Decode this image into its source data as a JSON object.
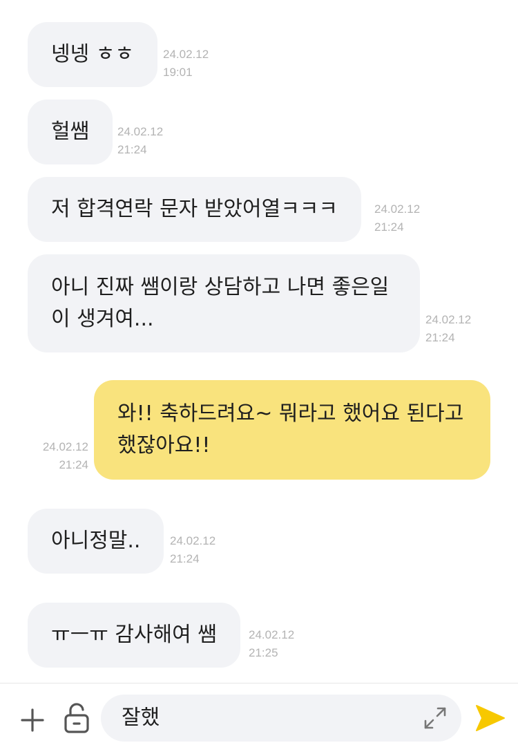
{
  "messages": [
    {
      "text": "넹넹 ㅎㅎ",
      "date": "24.02.12",
      "time": "19:01",
      "sender": "other"
    },
    {
      "text": "헐쌤",
      "date": "24.02.12",
      "time": "21:24",
      "sender": "other"
    },
    {
      "text": "저 합격연락 문자 받았어열ㅋㅋㅋ",
      "date": "24.02.12",
      "time": "21:24",
      "sender": "other"
    },
    {
      "line1": "아니 진짜 쌤이랑 상담하고 나면 좋은일",
      "line2": "이 생겨여...",
      "date": "24.02.12",
      "time": "21:24",
      "sender": "other"
    },
    {
      "line1": "와!! 축하드려요~ 뭐라고 했어요 된다고",
      "line2": "했잖아요!!",
      "date": "24.02.12",
      "time": "21:24",
      "sender": "me"
    },
    {
      "text": "아니정말..",
      "date": "24.02.12",
      "time": "21:24",
      "sender": "other"
    },
    {
      "text": "ㅠㅡㅠ 감사해여 쌤",
      "date": "24.02.12",
      "time": "21:25",
      "sender": "other"
    }
  ],
  "composer": {
    "input_value": "잘했",
    "icons": [
      "plus-icon",
      "unlock-icon",
      "expand-icon",
      "send-icon"
    ]
  },
  "colors": {
    "other_bubble": "#f2f3f6",
    "my_bubble": "#f9e37d",
    "timestamp": "#b3b3b3",
    "send": "#f7c800"
  }
}
